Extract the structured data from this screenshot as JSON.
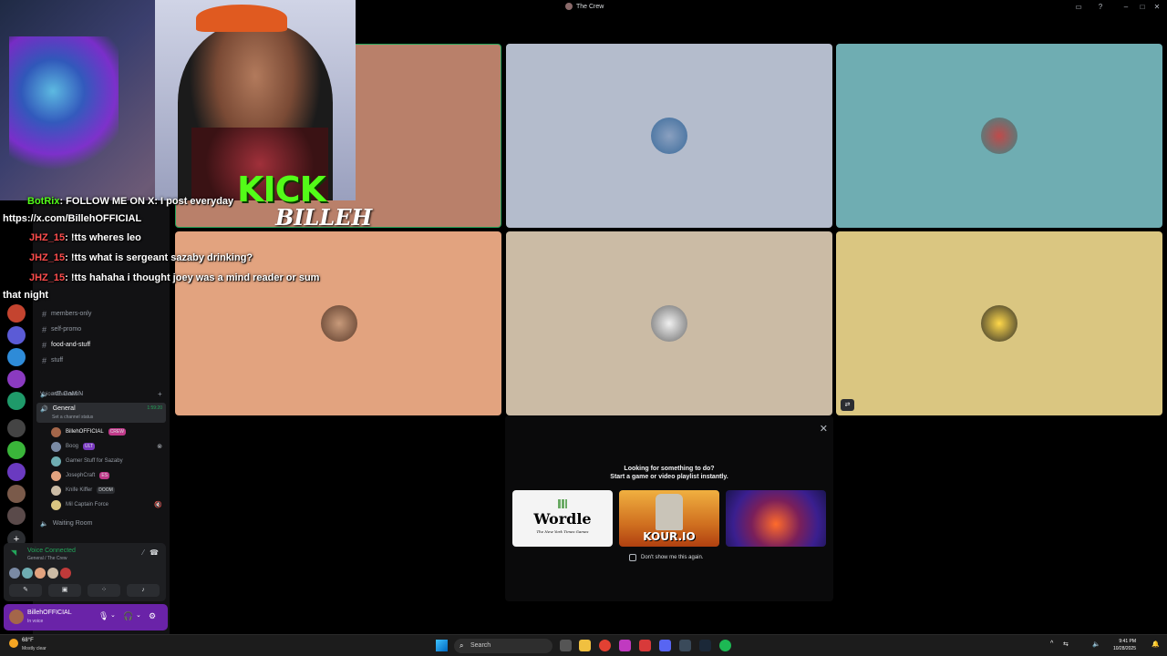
{
  "window": {
    "title": "The Crew"
  },
  "channels": [
    {
      "name": "members-only",
      "unread": false
    },
    {
      "name": "self-promo",
      "unread": false
    },
    {
      "name": "food-and-stuff",
      "unread": true
    },
    {
      "name": "stuff",
      "unread": false
    }
  ],
  "voice": {
    "header": "Voice Channels",
    "channels": [
      {
        "name": "wE GaMiN"
      },
      {
        "name": "General",
        "stat": "1:59:20",
        "status": "Set a channel status"
      },
      {
        "name": "Waiting Room"
      }
    ],
    "members": [
      {
        "name": "BillehOFFICIAL",
        "tag": "CREW",
        "color": "#c03a8a"
      },
      {
        "name": "Boog",
        "tag": "ULT",
        "color": "#7a3ac0"
      },
      {
        "name": "Gamer Stuff for Sazaby",
        "tag": "",
        "color": ""
      },
      {
        "name": "JosephCraft",
        "tag": "ES",
        "color": "#c03a8a"
      },
      {
        "name": "Knife Kiffer",
        "tag": "DOOM",
        "color": "#2b2d31"
      },
      {
        "name": "Mil Captain Force",
        "tag": "",
        "color": ""
      }
    ]
  },
  "vc_panel": {
    "connected": "Voice Connected",
    "location": "General / The Crew"
  },
  "user": {
    "name": "BillehOFFICIAL",
    "status": "In voice"
  },
  "overlay": {
    "kick_logo": "KICK",
    "billeh_logo": "BILLEH",
    "chat": [
      {
        "user": "BotRix",
        "text": ": FOLLOW ME ON X: I post everyday"
      },
      {
        "user": "",
        "text": "https://x.com/BillehOFFICIAL"
      },
      {
        "user": "JHZ_15",
        "text": ": !tts wheres leo"
      },
      {
        "user": "JHZ_15",
        "text": ": !tts what is sergeant sazaby drinking?"
      },
      {
        "user": "JHZ_15",
        "text": ": !tts hahaha i thought joey was a mind reader or sum"
      },
      {
        "user": "",
        "text": "that night"
      }
    ]
  },
  "activity": {
    "line1": "Looking for something to do?",
    "line2": "Start a game or video playlist instantly.",
    "games": [
      {
        "title": "Wordle",
        "subtitle": "The New York Times Games"
      },
      {
        "title": "KOUR.IO"
      },
      {
        "title": ""
      }
    ],
    "dont_show": "Don't show me this again."
  },
  "tiles": [
    {
      "bg": "#b9806a"
    },
    {
      "bg": "#b4bccc"
    },
    {
      "bg": "#6fadb2"
    },
    {
      "bg": "#e2a37f"
    },
    {
      "bg": "#cbbba5"
    },
    {
      "bg": "#dac681"
    }
  ],
  "taskbar": {
    "temperature": "68°F",
    "weather": "Mostly clear",
    "search": "Search",
    "time": "9:41 PM",
    "date": "10/28/2025"
  }
}
